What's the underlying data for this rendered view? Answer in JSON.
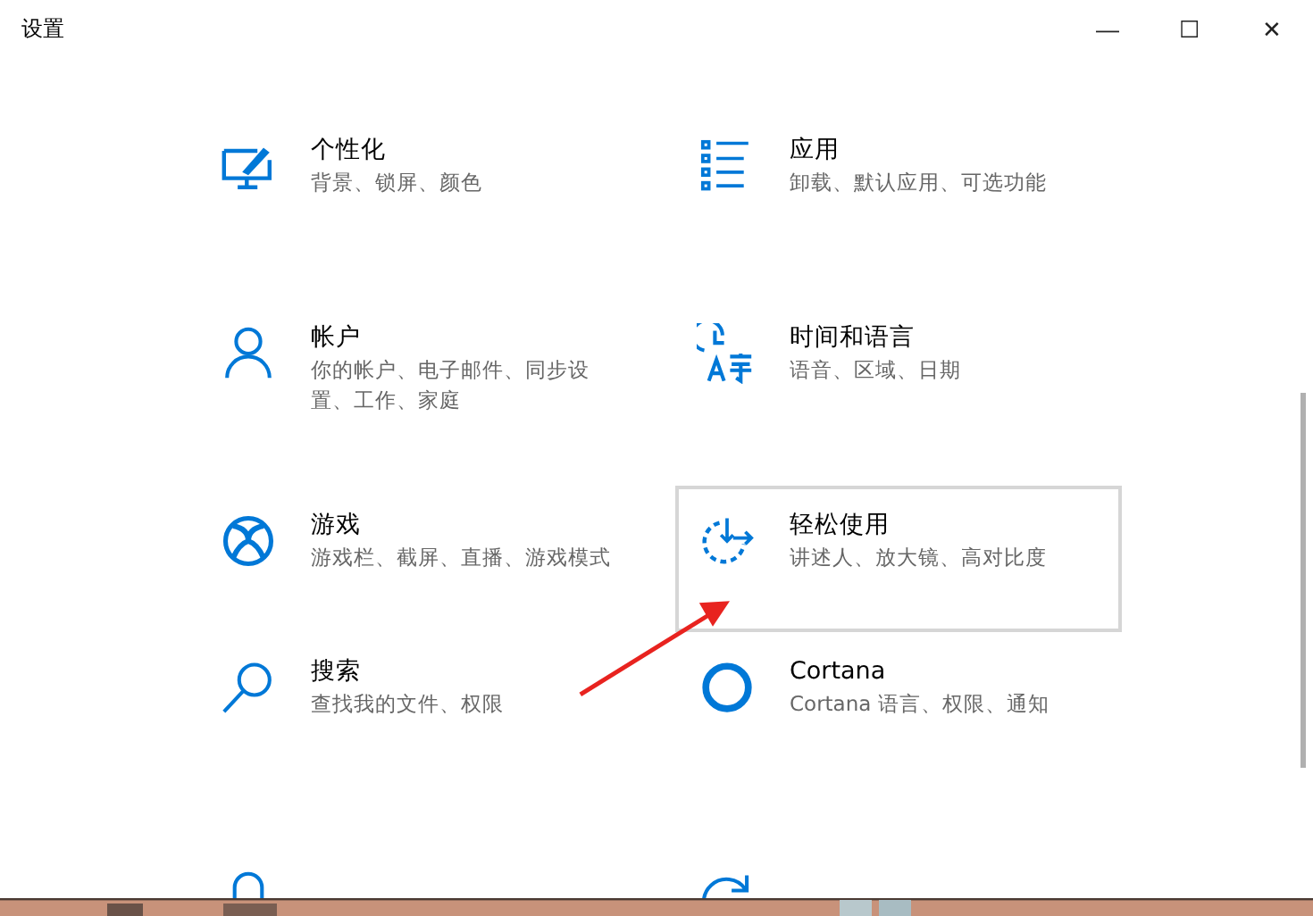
{
  "window": {
    "title": "设置",
    "controls": [
      "—",
      "☐",
      "✕"
    ]
  },
  "tiles": [
    {
      "kind": "personalize",
      "title": "个性化",
      "subtitle": "背景、锁屏、颜色",
      "hovered": false
    },
    {
      "kind": "apps",
      "title": "应用",
      "subtitle": "卸载、默认应用、可选功能",
      "hovered": false
    },
    {
      "kind": "account",
      "title": "帐户",
      "subtitle": "你的帐户、电子邮件、同步设置、工作、家庭",
      "hovered": false
    },
    {
      "kind": "time",
      "title": "时间和语言",
      "subtitle": "语音、区域、日期",
      "hovered": false
    },
    {
      "kind": "gaming",
      "title": "游戏",
      "subtitle": "游戏栏、截屏、直播、游戏模式",
      "hovered": false
    },
    {
      "kind": "ease",
      "title": "轻松使用",
      "subtitle": "讲述人、放大镜、高对比度",
      "hovered": true
    },
    {
      "kind": "search",
      "title": "搜索",
      "subtitle": "查找我的文件、权限",
      "hovered": false
    },
    {
      "kind": "cortana",
      "title": "Cortana",
      "subtitle": "Cortana 语言、权限、通知",
      "hovered": false
    },
    {
      "kind": "privacy",
      "hovered": false
    },
    {
      "kind": "update",
      "hovered": false
    }
  ]
}
